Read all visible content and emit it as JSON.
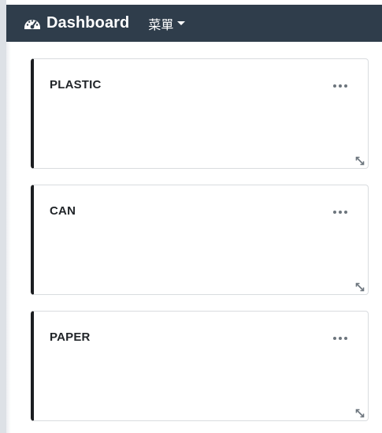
{
  "navbar": {
    "brand_icon": "tachometer-icon",
    "brand_label": "Dashboard",
    "menu_label": "菜單",
    "background": "#2f3d4b"
  },
  "cards": [
    {
      "title": "PLASTIC",
      "menu_icon": "ellipsis-icon",
      "resize_icon": "resize-icon"
    },
    {
      "title": "CAN",
      "menu_icon": "ellipsis-icon",
      "resize_icon": "resize-icon"
    },
    {
      "title": "PAPER",
      "menu_icon": "ellipsis-icon",
      "resize_icon": "resize-icon"
    }
  ],
  "colors": {
    "card_accent": "#1b1d20",
    "card_border": "#d9dcdf",
    "menu_dots": "#6c757d"
  }
}
